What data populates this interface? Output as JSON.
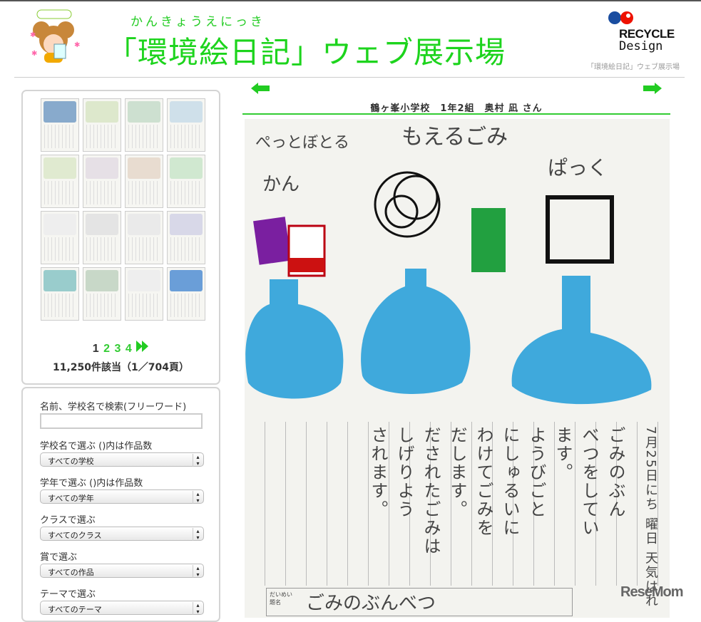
{
  "header": {
    "logo_text": "環境絵日記",
    "ruby": "かんきょうえにっき",
    "title": "「環境絵日記」ウェブ展示場",
    "recycle_word": "RECYCLE",
    "recycle_design": "Design",
    "subtitle": "「環境絵日記」ウェブ展示場"
  },
  "gallery": {
    "thumb_count": 16,
    "pages": [
      "1",
      "2",
      "3",
      "4"
    ],
    "current_page": "1",
    "next_icon": "double-arrow-right",
    "count_text": "11,250件該当（1／704頁）"
  },
  "filters": {
    "search_label": "名前、学校名で検索(フリーワード)",
    "search_value": "",
    "search_placeholder": "",
    "school_label": "学校名で選ぶ ()内は作品数",
    "school_value": "すべての学校",
    "grade_label": "学年で選ぶ ()内は作品数",
    "grade_value": "すべての学年",
    "class_label": "クラスで選ぶ",
    "class_value": "すべてのクラス",
    "award_label": "賞で選ぶ",
    "award_value": "すべての作品",
    "theme_label": "テーマで選ぶ",
    "theme_value": "すべてのテーマ"
  },
  "work": {
    "title": "鶴ヶ峯小学校　1年2組　奥村 凪 さん",
    "drawing_labels": [
      "ぺっとぼとる",
      "かん",
      "もえるごみ",
      "ぱっく"
    ],
    "diary_columns": [
      "7月25日にち 曜日 天気はれ",
      "ごみのぶん",
      "べつをしてい",
      "ます。",
      "ようびごと",
      "にしゅるいに",
      "わけてごみを",
      "だします。",
      "だされたごみは",
      "しげりよう",
      "されます。"
    ],
    "heading_label": "だいめい 題名",
    "heading": "ごみのぶんべつ"
  },
  "watermark": "ReseMom",
  "colors": {
    "accent": "#22cc22",
    "crayon_blue": "#3fa9dc"
  }
}
